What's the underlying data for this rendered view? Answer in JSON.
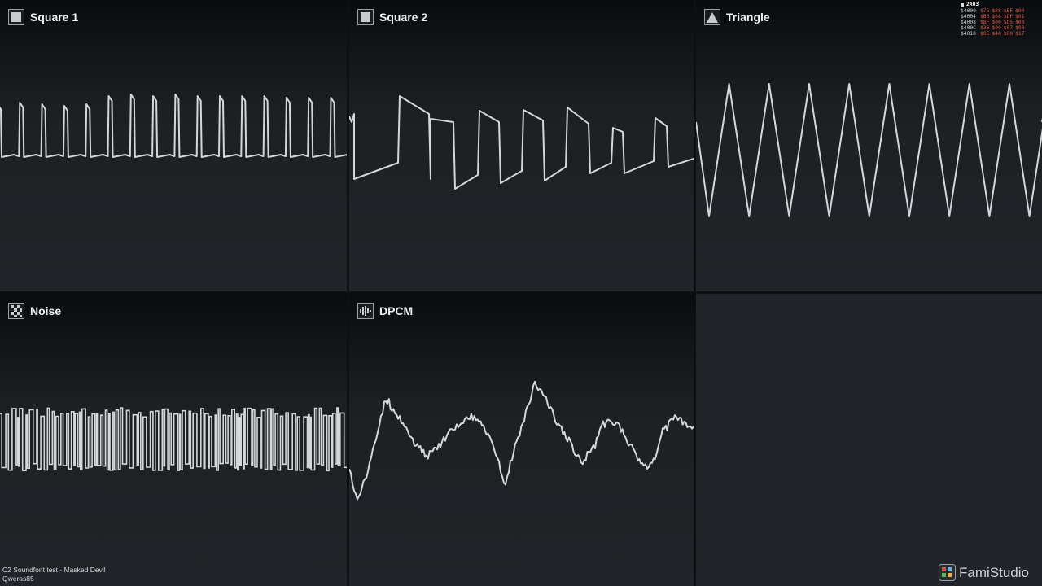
{
  "channels": [
    {
      "name": "Square 1",
      "icon": "square-wave-icon"
    },
    {
      "name": "Square 2",
      "icon": "square-wave-icon"
    },
    {
      "name": "Triangle",
      "icon": "triangle-wave-icon"
    },
    {
      "name": "Noise",
      "icon": "noise-icon"
    },
    {
      "name": "DPCM",
      "icon": "dpcm-icon"
    }
  ],
  "registers": {
    "chip": "2A03",
    "rows": [
      {
        "addr": "$4000",
        "vals": [
          "$75",
          "$08",
          "$EF",
          "$00"
        ]
      },
      {
        "addr": "$4004",
        "vals": [
          "$B6",
          "$08",
          "$DF",
          "$01"
        ]
      },
      {
        "addr": "$4008",
        "vals": [
          "$8F",
          "$00",
          "$D5",
          "$00"
        ]
      },
      {
        "addr": "$400C",
        "vals": [
          "$36",
          "$00",
          "$07",
          "$00"
        ]
      },
      {
        "addr": "$4010",
        "vals": [
          "$0E",
          "$40",
          "$00",
          "$17"
        ]
      }
    ]
  },
  "credits": {
    "song": "C2 Soundfont test - Masked Devil",
    "author": "Qweras85"
  },
  "brand": {
    "name": "FamiStudio"
  },
  "colors": {
    "waveform": "#d4d7da",
    "register_value": "#e0574a"
  }
}
